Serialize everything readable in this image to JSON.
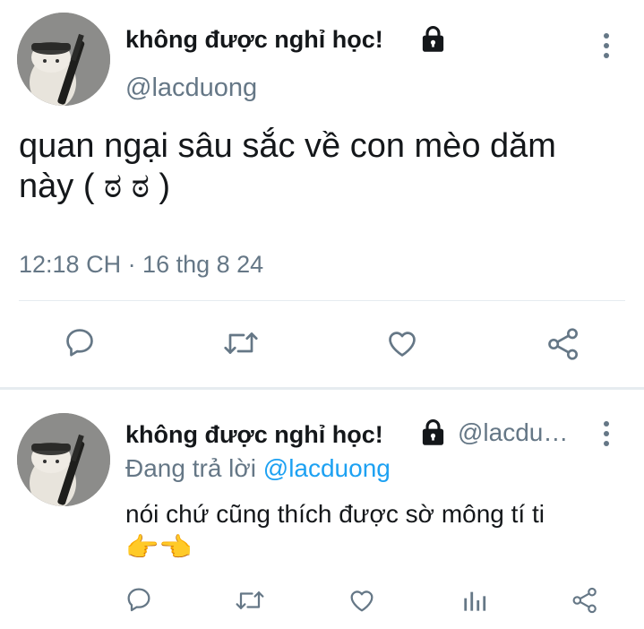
{
  "main_tweet": {
    "display_name": "không được nghỉ học!",
    "handle": "@lacduong",
    "text": "quan ngại sâu sắc về con mèo dăm này ( ಠ ಠ )",
    "timestamp": "12:18 CH · 16 thg 8 24",
    "actions": [
      "reply-icon",
      "retweet-icon",
      "like-icon",
      "share-icon"
    ]
  },
  "reply_tweet": {
    "display_name": "không được nghỉ học!",
    "handle": "@lacdu…",
    "replying_prefix": "Đang trả lời",
    "replying_to": "@lacduong",
    "text": "nói chứ cũng thích được sờ mông tí ti",
    "emoji": "👉👈",
    "actions": [
      "reply-icon",
      "retweet-icon",
      "like-icon",
      "analytics-icon",
      "share-icon"
    ]
  },
  "colors": {
    "text": "#14171a",
    "muted": "#657786",
    "link": "#1da1f2",
    "divider": "#e6ecf0"
  }
}
